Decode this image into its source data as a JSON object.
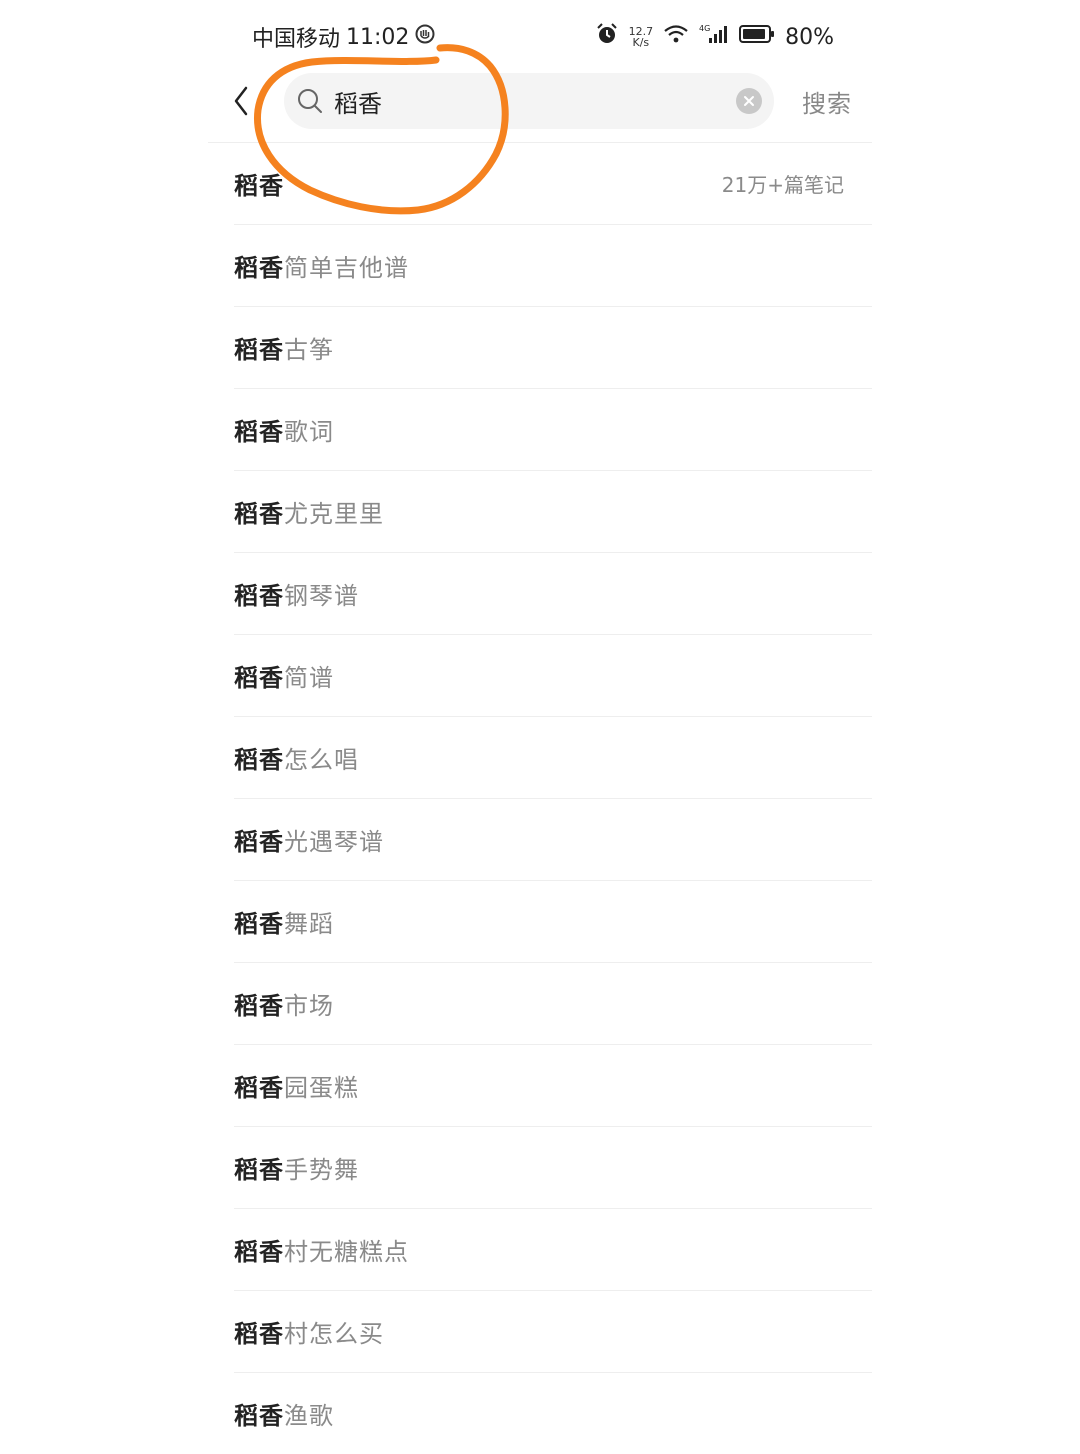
{
  "status_bar": {
    "carrier": "中国移动",
    "time": "11:02",
    "net_speed_value": "12.7",
    "net_speed_unit": "K/s",
    "battery": "80%"
  },
  "header": {
    "search_value": "稻香",
    "search_action": "搜索"
  },
  "suggestions": [
    {
      "match": "稻香",
      "rest": "",
      "count": "21万+篇笔记"
    },
    {
      "match": "稻香",
      "rest": "简单吉他谱"
    },
    {
      "match": "稻香",
      "rest": "古筝"
    },
    {
      "match": "稻香",
      "rest": "歌词"
    },
    {
      "match": "稻香",
      "rest": "尤克里里"
    },
    {
      "match": "稻香",
      "rest": "钢琴谱"
    },
    {
      "match": "稻香",
      "rest": "简谱"
    },
    {
      "match": "稻香",
      "rest": "怎么唱"
    },
    {
      "match": "稻香",
      "rest": "光遇琴谱"
    },
    {
      "match": "稻香",
      "rest": "舞蹈"
    },
    {
      "match": "稻香",
      "rest": "市场"
    },
    {
      "match": "稻香",
      "rest": "园蛋糕"
    },
    {
      "match": "稻香",
      "rest": "手势舞"
    },
    {
      "match": "稻香",
      "rest": "村无糖糕点"
    },
    {
      "match": "稻香",
      "rest": "村怎么买"
    },
    {
      "match": "稻香",
      "rest": "渔歌"
    }
  ],
  "colors": {
    "annotation": "#f5821f",
    "secondary_text": "#8a8a8a",
    "search_bg": "#f4f4f4"
  },
  "icons": [
    "back-chevron-icon",
    "search-icon",
    "clear-icon",
    "alarm-icon",
    "wifi-icon",
    "signal-icon",
    "battery-icon",
    "app-notification-icon"
  ]
}
